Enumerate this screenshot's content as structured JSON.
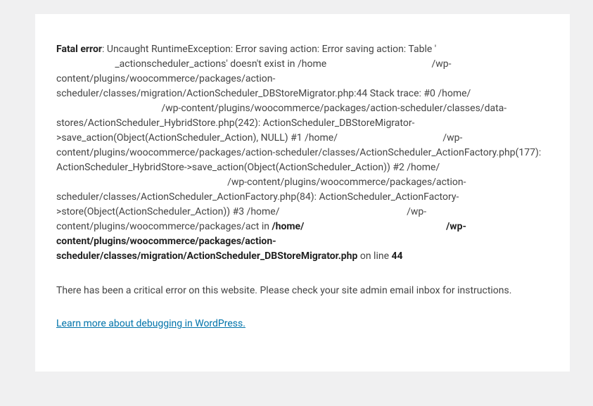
{
  "error": {
    "label": "Fatal error",
    "message_part1": ": Uncaught RuntimeException: Error saving action: Error saving action: Table '",
    "message_part2": "_actionscheduler_actions' doesn't exist in /home",
    "message_part3": "/wp-content/plugins/woocommerce/packages/action-scheduler/classes/migration/ActionScheduler_DBStoreMigrator.php:44 Stack trace: #0 /home/",
    "message_part4": "/wp-content/plugins/woocommerce/packages/action-scheduler/classes/data-stores/ActionScheduler_HybridStore.php(242): ActionScheduler_DBStoreMigrator->save_action(Object(ActionScheduler_Action), NULL) #1 /home/",
    "message_part5": "/wp-content/plugins/woocommerce/packages/action-scheduler/classes/ActionScheduler_ActionFactory.php(177): ActionScheduler_HybridStore->save_action(Object(ActionScheduler_Action)) #2 /home/",
    "message_part6": "/wp-content/plugins/woocommerce/packages/action-scheduler/classes/ActionScheduler_ActionFactory.php(84): ActionScheduler_ActionFactory->store(Object(ActionScheduler_Action)) #3 /home/",
    "message_part7": "/wp-content/plugins/woocommerce/packages/act in ",
    "bold_path": "/home/",
    "bold_path2": "/wp-content/plugins/woocommerce/packages/action-scheduler/classes/migration/ActionScheduler_DBStoreMigrator.php",
    "on_line_text": " on line ",
    "line_number": "44"
  },
  "critical_notice": "There has been a critical error on this website. Please check your site admin email inbox for instructions.",
  "debug_link": "Learn more about debugging in WordPress.",
  "spacing": {
    "pad_medium": "                        ",
    "pad_large": "                                           ",
    "pad_xlarge": "                                                                             ",
    "pad_small": "                                      ",
    "pad_tail1": "                                                                      ",
    "pad_tail2": "                                                    ",
    "pad_tail3": "                                                          "
  }
}
